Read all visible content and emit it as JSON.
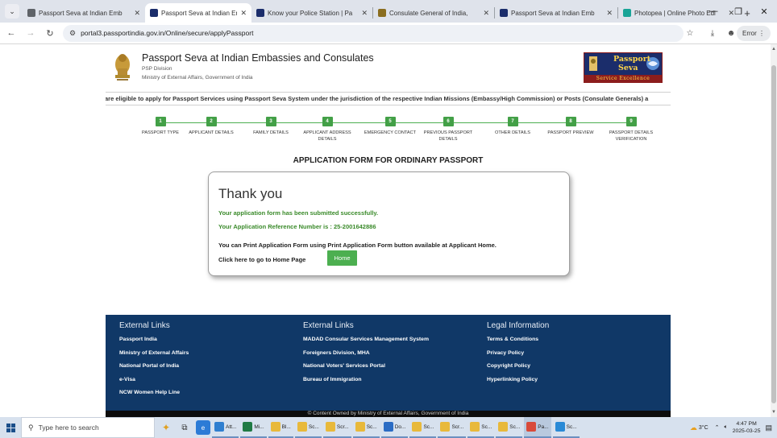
{
  "browser": {
    "tabs": [
      {
        "title": "Passport Seva at Indian Emb",
        "favicon": "globe-icon",
        "color": "#5f6368",
        "active": false
      },
      {
        "title": "Passport Seva at Indian Emb",
        "favicon": "passport-seva-favicon",
        "color": "#1b2d6b",
        "active": true
      },
      {
        "title": "Know your Police Station | Pa",
        "favicon": "passport-seva-favicon",
        "color": "#1b2d6b",
        "active": false
      },
      {
        "title": "Consulate General of India, ",
        "favicon": "emblem-favicon",
        "color": "#8a6d1f",
        "active": false
      },
      {
        "title": "Passport Seva at Indian Emb",
        "favicon": "passport-seva-favicon",
        "color": "#1b2d6b",
        "active": false
      },
      {
        "title": "Photopea | Online Photo Edi",
        "favicon": "photopea-favicon",
        "color": "#18a497",
        "active": false
      }
    ],
    "url": "portal3.passportindia.gov.in/Online/secure/applyPassport",
    "error_label": "Error"
  },
  "header": {
    "title": "Passport Seva at Indian Embassies and Consulates",
    "sub1": "PSP Division",
    "sub2": "Ministry of External Affairs, Government of India",
    "logo_line1": "Passport",
    "logo_line2": "Seva",
    "logo_tagline": "Service Excellence"
  },
  "marquee": "are eligible to apply for Passport Services using Passport Seva System under the jurisdiction of the respective Indian Missions (Embassy/High Commission) or Posts (Consulate Generals) a",
  "steps": [
    {
      "num": "1",
      "label": "PASSPORT TYPE"
    },
    {
      "num": "2",
      "label": "APPLICANT DETAILS"
    },
    {
      "num": "3",
      "label": "FAMILY DETAILS"
    },
    {
      "num": "4",
      "label": "APPLICANT ADDRESS DETAILS"
    },
    {
      "num": "5",
      "label": "EMERGENCY CONTACT"
    },
    {
      "num": "6",
      "label": "PREVIOUS PASSPORT DETAILS"
    },
    {
      "num": "7",
      "label": "OTHER DETAILS"
    },
    {
      "num": "8",
      "label": "PASSPORT PREVIEW"
    },
    {
      "num": "9",
      "label": "PASSPORT DETAILS VERIFICATION"
    }
  ],
  "form_title": "APPLICATION FORM FOR ORDINARY PASSPORT",
  "dialog": {
    "heading": "Thank you",
    "success": "Your application form has been submitted successfully.",
    "reference": "Your Application Reference Number is : 25-2001642886",
    "print_info": "You can Print Application Form using Print Application Form button available at Applicant Home.",
    "home_prompt": "Click here to go to Home Page",
    "home_button": "Home"
  },
  "footer": {
    "col1": {
      "heading": "External Links",
      "links": [
        "Passport India",
        "Ministry of External Affairs",
        "National Portal of India",
        "e-Visa",
        "NCW Women Help Line"
      ]
    },
    "col2": {
      "heading": "External Links",
      "links": [
        "MADAD Consular Services Management System",
        "Foreigners Division, MHA",
        "National Voters' Services Portal",
        "Bureau of Immigration"
      ]
    },
    "col3": {
      "heading": "Legal Information",
      "links": [
        "Terms & Conditions",
        "Privacy Policy",
        "Copyright Policy",
        "Hyperlinking Policy"
      ]
    },
    "copyright": "© Content Owned by Ministry of External Affairs, Government of India"
  },
  "taskbar": {
    "search_placeholder": "Type here to search",
    "apps": [
      {
        "label": "Att...",
        "icon": "chrome-icon",
        "color": "#2f7fd0"
      },
      {
        "label": "Mi...",
        "icon": "excel-icon",
        "color": "#1f7a44"
      },
      {
        "label": "Bl...",
        "icon": "folder-icon",
        "color": "#e8b93b"
      },
      {
        "label": "Sc...",
        "icon": "folder-icon",
        "color": "#e8b93b"
      },
      {
        "label": "Scr...",
        "icon": "folder-icon",
        "color": "#e8b93b"
      },
      {
        "label": "Sc...",
        "icon": "folder-icon",
        "color": "#e8b93b"
      },
      {
        "label": "Do...",
        "icon": "download-icon",
        "color": "#2b6cc4"
      },
      {
        "label": "Sc...",
        "icon": "folder-icon",
        "color": "#e8b93b"
      },
      {
        "label": "Scr...",
        "icon": "folder-icon",
        "color": "#e8b93b"
      },
      {
        "label": "Sc...",
        "icon": "folder-icon",
        "color": "#e8b93b"
      },
      {
        "label": "Sc...",
        "icon": "folder-icon",
        "color": "#e8b93b"
      },
      {
        "label": "Pa...",
        "icon": "chrome-icon",
        "color": "#d94a3a"
      },
      {
        "label": "Sc...",
        "icon": "snip-icon",
        "color": "#2a8ad6"
      }
    ],
    "temperature": "3°C",
    "time": "4:47 PM",
    "date": "2025-03-25"
  }
}
